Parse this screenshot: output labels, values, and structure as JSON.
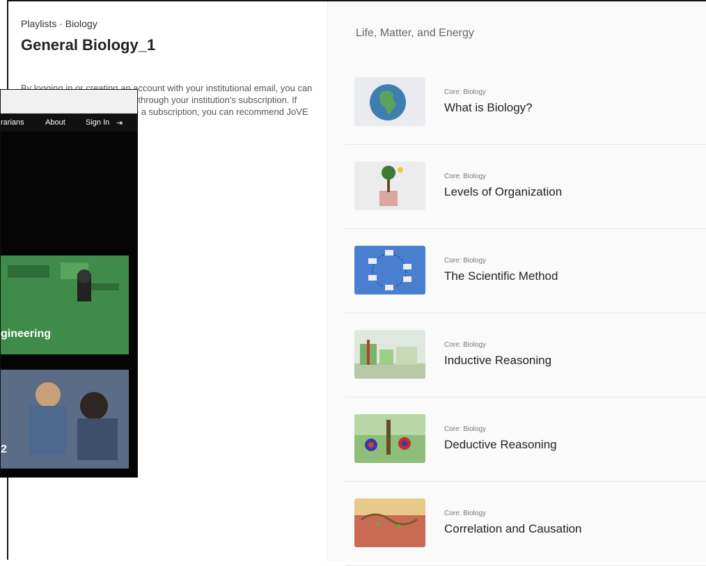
{
  "left": {
    "breadcrumb": "Playlists · Biology",
    "title": "General Biology_1",
    "description": "By logging in or creating an account with your institutional email, you can watch JoVE videos available through your institution's subscription. If your institution does not have a subscription, you can recommend JoVE to your librarian.",
    "playlists_link": "playlists"
  },
  "right": {
    "section_title": "Life, Matter, and Energy",
    "items": [
      {
        "category": "Core: Biology",
        "title": "What is Biology?"
      },
      {
        "category": "Core: Biology",
        "title": "Levels of Organization"
      },
      {
        "category": "Core: Biology",
        "title": "The Scientific Method"
      },
      {
        "category": "Core: Biology",
        "title": "Inductive Reasoning"
      },
      {
        "category": "Core: Biology",
        "title": "Deductive Reasoning"
      },
      {
        "category": "Core: Biology",
        "title": "Correlation and Causation"
      }
    ]
  },
  "overlay": {
    "nav": {
      "librarians": "rarians",
      "about": "About",
      "sign_in": "Sign In"
    },
    "cards": [
      {
        "label": "gineering"
      },
      {
        "label": "2"
      }
    ]
  },
  "colors": {
    "link": "#3a7fc0",
    "nav_bg": "#111111",
    "overlay_bg": "#050505"
  }
}
